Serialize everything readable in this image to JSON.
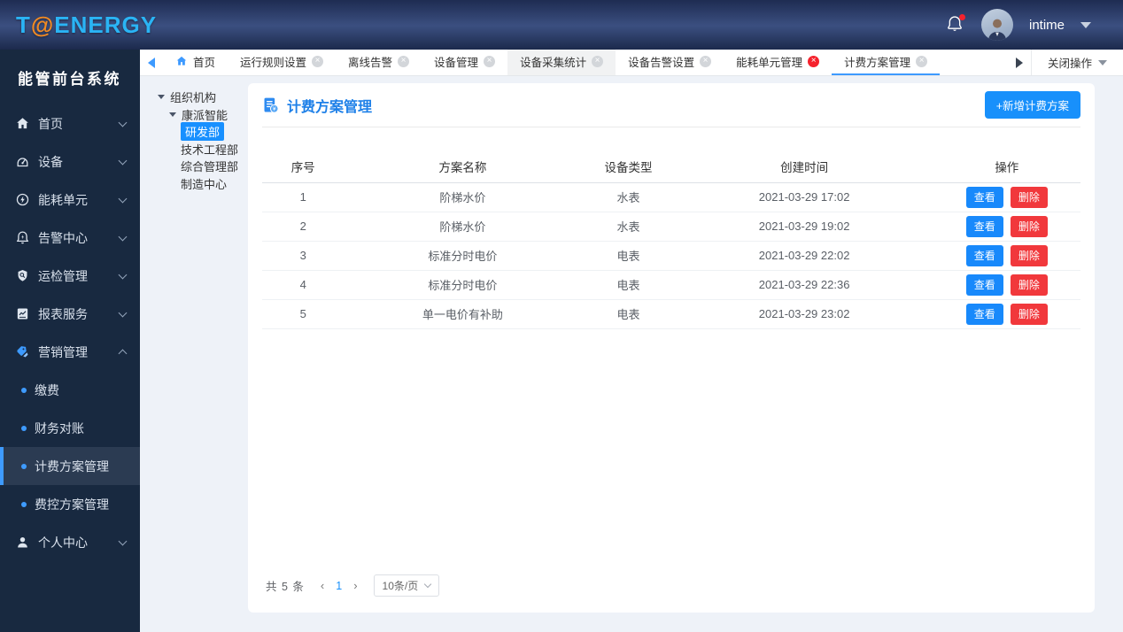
{
  "header": {
    "logo_t": "T",
    "logo_at": "@",
    "logo_rest": "ENERGY",
    "user": "intime",
    "notification_badge": true
  },
  "sidebar": {
    "title": "能管前台系统",
    "items": [
      {
        "id": "home",
        "icon": "home",
        "label": "首页"
      },
      {
        "id": "device",
        "icon": "device",
        "label": "设备"
      },
      {
        "id": "energy-unit",
        "icon": "energy",
        "label": "能耗单元"
      },
      {
        "id": "alarm-center",
        "icon": "alarm",
        "label": "告警中心"
      },
      {
        "id": "inspection",
        "icon": "inspection",
        "label": "运检管理"
      },
      {
        "id": "reports",
        "icon": "report",
        "label": "报表服务"
      },
      {
        "id": "marketing",
        "icon": "marketing",
        "label": "营销管理",
        "expanded": true,
        "children": [
          {
            "id": "payment",
            "label": "缴费"
          },
          {
            "id": "finance-reconciliation",
            "label": "财务对账"
          },
          {
            "id": "billing-plan",
            "label": "计费方案管理",
            "active": true
          },
          {
            "id": "fee-control-plan",
            "label": "费控方案管理"
          }
        ]
      },
      {
        "id": "personal-center",
        "icon": "person",
        "label": "个人中心"
      }
    ]
  },
  "tabbar": {
    "tabs": [
      {
        "id": "home",
        "label": "首页",
        "home": true,
        "closable": false
      },
      {
        "id": "run-rules",
        "label": "运行规则设置",
        "closable": true
      },
      {
        "id": "offline-alarm",
        "label": "离线告警",
        "closable": true
      },
      {
        "id": "device-mgmt",
        "label": "设备管理",
        "closable": true
      },
      {
        "id": "device-collect-stats",
        "label": "设备采集统计",
        "closable": true,
        "highlighted": true
      },
      {
        "id": "device-alarm-settings",
        "label": "设备告警设置",
        "closable": true
      },
      {
        "id": "energy-unit-mgmt",
        "label": "能耗单元管理",
        "closable": true,
        "close_red": true
      },
      {
        "id": "billing-plan-mgmt",
        "label": "计费方案管理",
        "closable": true,
        "active": true
      }
    ],
    "close_menu": "关闭操作"
  },
  "tree": {
    "nodes": [
      {
        "label": "组织机构",
        "level": 0,
        "caret": true
      },
      {
        "label": "康派智能",
        "level": 1,
        "caret": true
      },
      {
        "label": "研发部",
        "level": 2,
        "selected": true
      },
      {
        "label": "技术工程部",
        "level": 2
      },
      {
        "label": "综合管理部",
        "level": 2
      },
      {
        "label": "制造中心",
        "level": 2
      }
    ]
  },
  "main": {
    "title": "计费方案管理",
    "add_button": "+新增计费方案",
    "table": {
      "headers": [
        "序号",
        "方案名称",
        "设备类型",
        "创建时间",
        "操作"
      ],
      "rows": [
        {
          "no": "1",
          "name": "阶梯水价",
          "type": "水表",
          "created": "2021-03-29 17:02"
        },
        {
          "no": "2",
          "name": "阶梯水价",
          "type": "水表",
          "created": "2021-03-29 19:02"
        },
        {
          "no": "3",
          "name": "标准分时电价",
          "type": "电表",
          "created": "2021-03-29 22:02"
        },
        {
          "no": "4",
          "name": "标准分时电价",
          "type": "电表",
          "created": "2021-03-29 22:36"
        },
        {
          "no": "5",
          "name": "单一电价有补助",
          "type": "电表",
          "created": "2021-03-29 23:02"
        }
      ],
      "actions": {
        "view": "查看",
        "delete": "删除"
      }
    },
    "pagination": {
      "total_text": "共 5 条",
      "prev": "‹",
      "next": "›",
      "current_page": "1",
      "page_size": "10条/页"
    }
  },
  "colors": {
    "accent_blue": "#3d9aff",
    "primary_button": "#1890fb",
    "view_button": "#1889fb",
    "delete_button": "#f1383c",
    "title_blue": "#1e80e8",
    "logo_cyan": "#2ab4f5",
    "logo_orange": "#f18a23",
    "sidebar_bg": "#182940",
    "header_gradient_mid": "#3b4f80",
    "page_bg": "#eef2f8"
  }
}
